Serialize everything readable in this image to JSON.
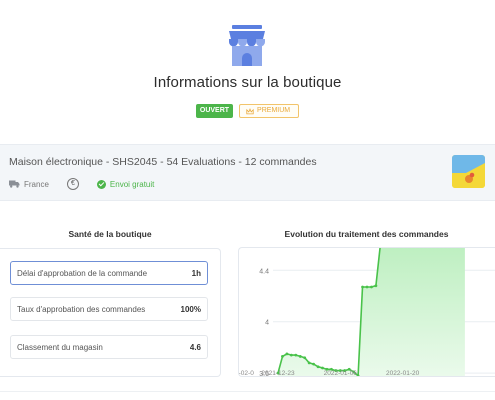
{
  "header": {
    "title": "Informations sur la boutique",
    "status_badge": "OUVERT",
    "tier_badge": "PREMIUM",
    "colors": {
      "accent_blue": "#5b7fe0",
      "open_green": "#4cb54a",
      "premium_gold": "#e9a93a"
    }
  },
  "shop": {
    "summary": "Maison électronique - SHS2045 - 54 Evaluations - 12 commandes",
    "country": "France",
    "currency_symbol": "€",
    "shipping": "Envoi gratuit"
  },
  "health": {
    "title": "Santé de la boutique",
    "metrics": [
      {
        "label": "Délai d'approbation de la commande",
        "value": "1h"
      },
      {
        "label": "Taux d'approbation des commandes",
        "value": "100%"
      },
      {
        "label": "Classement du magasin",
        "value": "4.6"
      }
    ]
  },
  "chart_data": {
    "type": "area",
    "title": "Evolution du traitement des commandes",
    "color": "#49c24a",
    "ylim": [
      3.5,
      4.55
    ],
    "yticks": [
      3.6,
      4,
      4.4
    ],
    "xticks": [
      "2021-12-23",
      "2022-01-06",
      "2022-01-20",
      "2022-02-0"
    ],
    "grid": true,
    "series": [
      {
        "values": [
          {
            "x": "2021-12-23",
            "y": 3.6
          },
          {
            "x": "2021-12-24",
            "y": 3.73
          },
          {
            "x": "2021-12-25",
            "y": 3.75
          },
          {
            "x": "2021-12-26",
            "y": 3.74
          },
          {
            "x": "2021-12-27",
            "y": 3.74
          },
          {
            "x": "2021-12-28",
            "y": 3.73
          },
          {
            "x": "2021-12-29",
            "y": 3.72
          },
          {
            "x": "2021-12-30",
            "y": 3.68
          },
          {
            "x": "2021-12-31",
            "y": 3.67
          },
          {
            "x": "2022-01-01",
            "y": 3.65
          },
          {
            "x": "2022-01-02",
            "y": 3.64
          },
          {
            "x": "2022-01-03",
            "y": 3.63
          },
          {
            "x": "2022-01-04",
            "y": 3.63
          },
          {
            "x": "2022-01-05",
            "y": 3.62
          },
          {
            "x": "2022-01-06",
            "y": 3.62
          },
          {
            "x": "2022-01-07",
            "y": 3.62
          },
          {
            "x": "2022-01-08",
            "y": 3.63
          },
          {
            "x": "2022-01-09",
            "y": 3.61
          },
          {
            "x": "2022-01-10",
            "y": 3.58
          },
          {
            "x": "2022-01-11",
            "y": 4.27
          },
          {
            "x": "2022-01-12",
            "y": 4.27
          },
          {
            "x": "2022-01-13",
            "y": 4.27
          },
          {
            "x": "2022-01-14",
            "y": 4.28
          },
          {
            "x": "2022-01-15",
            "y": 4.6
          },
          {
            "x": "2022-01-18",
            "y": 4.6
          },
          {
            "x": "2022-01-22",
            "y": 4.6
          },
          {
            "x": "2022-01-26",
            "y": 4.6
          },
          {
            "x": "2022-01-30",
            "y": 4.6
          },
          {
            "x": "2022-02-03",
            "y": 4.6
          }
        ]
      }
    ]
  }
}
